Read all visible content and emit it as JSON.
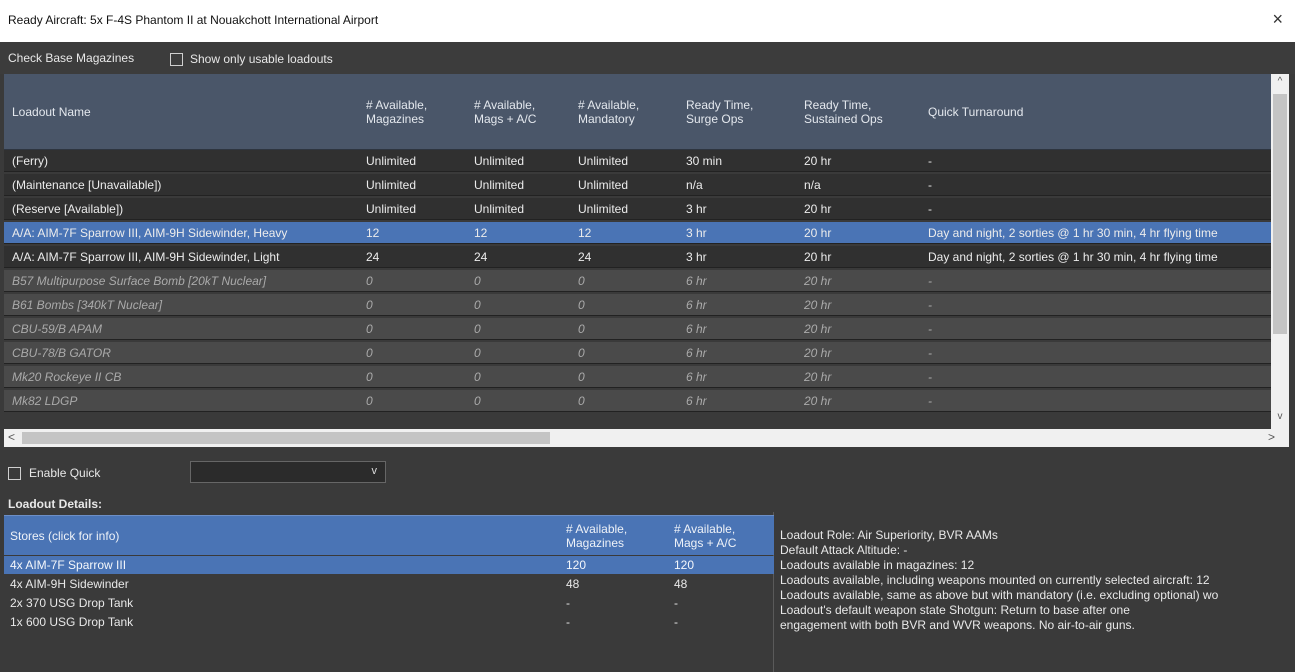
{
  "window": {
    "title": "Ready Aircraft: 5x F-4S Phantom II at Nouakchott International Airport",
    "close_glyph": "×"
  },
  "toolbar": {
    "check_base_magazines": "Check Base Magazines",
    "show_usable_label": "Show only usable loadouts"
  },
  "grid": {
    "columns": [
      "Loadout Name",
      "# Available, Magazines",
      "# Available, Mags + A/C",
      "# Available, Mandatory",
      "Ready Time, Surge Ops",
      "Ready Time, Sustained Ops",
      "Quick Turnaround"
    ],
    "rows": [
      {
        "name": "(Ferry)",
        "mags": "Unlimited",
        "mags_ac": "Unlimited",
        "mandatory": "Unlimited",
        "surge": "30 min",
        "sustained": "20 hr",
        "quick": "-",
        "style": "dark"
      },
      {
        "name": "(Maintenance [Unavailable])",
        "mags": "Unlimited",
        "mags_ac": "Unlimited",
        "mandatory": "Unlimited",
        "surge": "n/a",
        "sustained": "n/a",
        "quick": "-",
        "style": "dark"
      },
      {
        "name": "(Reserve [Available])",
        "mags": "Unlimited",
        "mags_ac": "Unlimited",
        "mandatory": "Unlimited",
        "surge": "3 hr",
        "sustained": "20 hr",
        "quick": "-",
        "style": "dark"
      },
      {
        "name": "A/A: AIM-7F Sparrow III, AIM-9H Sidewinder, Heavy",
        "mags": "12",
        "mags_ac": "12",
        "mandatory": "12",
        "surge": "3 hr",
        "sustained": "20 hr",
        "quick": "Day and night, 2 sorties @ 1 hr 30 min, 4 hr flying time",
        "style": "sel"
      },
      {
        "name": "A/A: AIM-7F Sparrow III, AIM-9H Sidewinder, Light",
        "mags": "24",
        "mags_ac": "24",
        "mandatory": "24",
        "surge": "3 hr",
        "sustained": "20 hr",
        "quick": "Day and night, 2 sorties @ 1 hr 30 min, 4 hr flying time",
        "style": "dark"
      },
      {
        "name": "B57 Multipurpose Surface Bomb [20kT Nuclear]",
        "mags": "0",
        "mags_ac": "0",
        "mandatory": "0",
        "surge": "6 hr",
        "sustained": "20 hr",
        "quick": "-",
        "style": "dim"
      },
      {
        "name": "B61 Bombs [340kT Nuclear]",
        "mags": "0",
        "mags_ac": "0",
        "mandatory": "0",
        "surge": "6 hr",
        "sustained": "20 hr",
        "quick": "-",
        "style": "dim"
      },
      {
        "name": "CBU-59/B APAM",
        "mags": "0",
        "mags_ac": "0",
        "mandatory": "0",
        "surge": "6 hr",
        "sustained": "20 hr",
        "quick": "-",
        "style": "dim"
      },
      {
        "name": "CBU-78/B GATOR",
        "mags": "0",
        "mags_ac": "0",
        "mandatory": "0",
        "surge": "6 hr",
        "sustained": "20 hr",
        "quick": "-",
        "style": "dim"
      },
      {
        "name": "Mk20 Rockeye II CB",
        "mags": "0",
        "mags_ac": "0",
        "mandatory": "0",
        "surge": "6 hr",
        "sustained": "20 hr",
        "quick": "-",
        "style": "dim"
      },
      {
        "name": "Mk82 LDGP",
        "mags": "0",
        "mags_ac": "0",
        "mandatory": "0",
        "surge": "6 hr",
        "sustained": "20 hr",
        "quick": "-",
        "style": "dim"
      }
    ]
  },
  "scrollbars": {
    "up": "^",
    "down": "v",
    "left": "<",
    "right": ">"
  },
  "quick": {
    "enable_label": "Enable Quick",
    "combo_value": "",
    "combo_arrow": "v"
  },
  "details": {
    "label": "Loadout Details:",
    "columns": [
      "Stores (click for info)",
      "# Available, Magazines",
      "# Available, Mags + A/C"
    ],
    "rows": [
      {
        "store": "4x AIM-7F Sparrow III",
        "mags": "120",
        "mags_ac": "120",
        "selected": true
      },
      {
        "store": "4x AIM-9H Sidewinder",
        "mags": "48",
        "mags_ac": "48",
        "selected": false
      },
      {
        "store": "2x 370 USG Drop Tank",
        "mags": "-",
        "mags_ac": "-",
        "selected": false
      },
      {
        "store": "1x 600 USG Drop Tank",
        "mags": "-",
        "mags_ac": "-",
        "selected": false
      }
    ]
  },
  "info": {
    "lines": [
      "Loadout Role: Air Superiority, BVR AAMs",
      "Default Attack Altitude: -",
      "Loadouts available in magazines: 12",
      "Loadouts available, including weapons mounted on currently selected aircraft: 12",
      "Loadouts available, same as above but with mandatory (i.e. excluding optional) wo",
      "Loadout's default weapon state Shotgun: Return to base after one",
      "engagement with both BVR and WVR weapons. No air-to-air guns."
    ]
  }
}
